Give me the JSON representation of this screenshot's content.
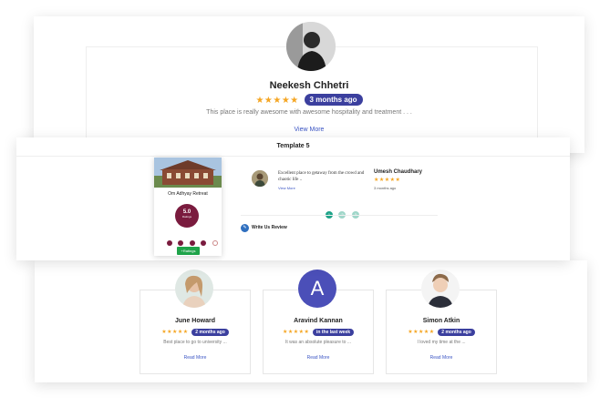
{
  "top_card": {
    "name": "Neekesh Chhetri",
    "stars": "★★★★★",
    "time_badge": "3 months ago",
    "review_text": "This place is really awesome with awesome hospitality and treatment . . .",
    "view_more": "View More"
  },
  "template_card": {
    "title": "Template 5",
    "hotel": {
      "name": "Om Adhyay Retreat",
      "score": "5.0",
      "score_label": "Ratings",
      "button_label": "+Ratings"
    },
    "review": {
      "text": "Excellent place to getaway from the crowd and chaotic life ..",
      "view_more": "View More",
      "reviewer": "Umesh Chaudhary",
      "stars": "★★★★★",
      "time": "3 months ago"
    },
    "pagination": [
      "1",
      "2",
      "3"
    ],
    "write_review_label": "Write Us Review"
  },
  "bottom_reviews": [
    {
      "name": "June Howard",
      "stars": "★★★★★",
      "badge": "2 months ago",
      "text": "Best place to go to university ...",
      "read_more": "Read More"
    },
    {
      "name": "Aravind Kannan",
      "initial": "A",
      "stars": "★★★★★",
      "badge": "in the last week",
      "text": "It was an absolute pleasure to ...",
      "read_more": "Read More"
    },
    {
      "name": "Simon Atkin",
      "stars": "★★★★★",
      "badge": "2 months ago",
      "text": "I loved my time at the ...",
      "read_more": "Read More"
    }
  ],
  "colors": {
    "badge": "#3b3f9e",
    "star": "#f5a623",
    "score": "#7a1b3e",
    "avatar_a": "#4b4fb8",
    "green": "#1fa34a"
  }
}
